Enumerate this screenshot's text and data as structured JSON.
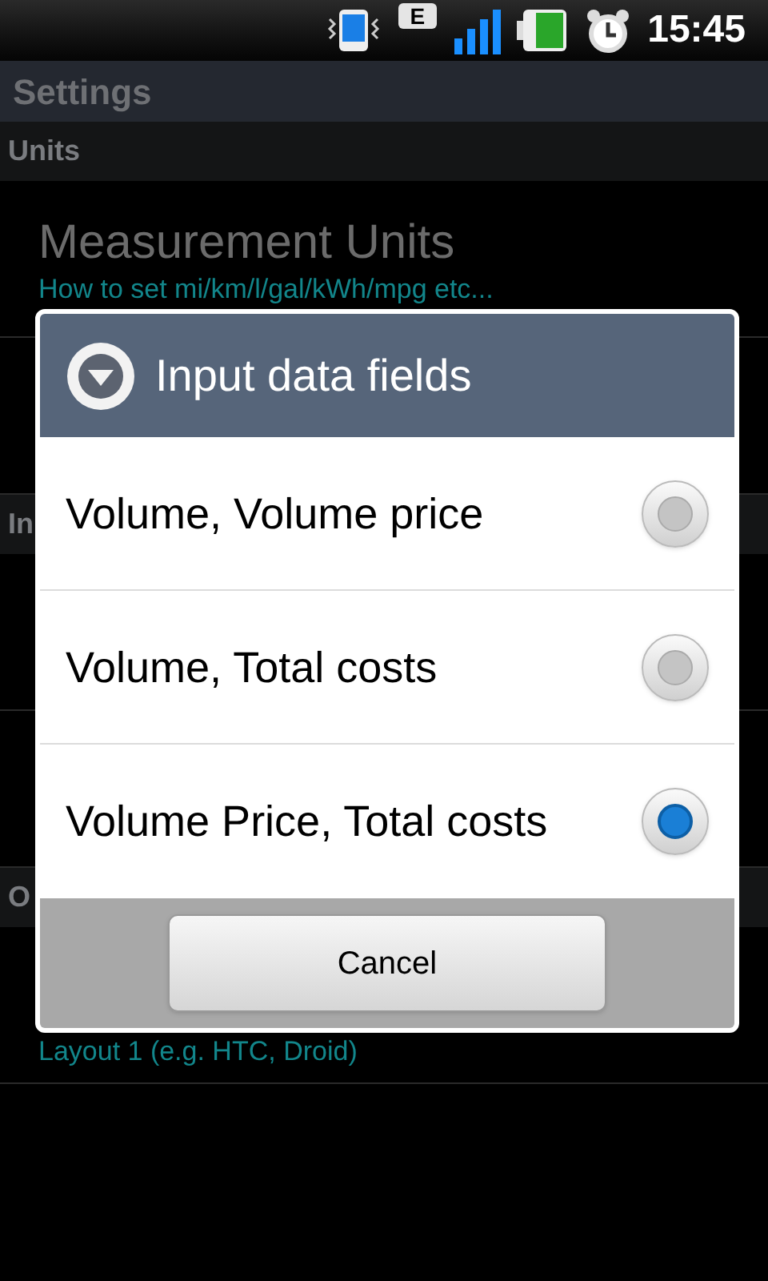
{
  "status_bar": {
    "network": "E",
    "time": "15:45"
  },
  "title": "Settings",
  "rows": [
    {
      "kind": "header",
      "text": "Units"
    },
    {
      "kind": "item",
      "title": "Measurement Units",
      "summary": "How to set mi/km/l/gal/kWh/mpg etc..."
    },
    {
      "kind": "hidden"
    },
    {
      "kind": "header",
      "text": "In"
    },
    {
      "kind": "hidden"
    },
    {
      "kind": "hidden"
    },
    {
      "kind": "header",
      "text": "O"
    },
    {
      "kind": "item",
      "summary": "Layout 1 (e.g. HTC, Droid)"
    }
  ],
  "dialog": {
    "title": "Input data fields",
    "options": [
      {
        "label": "Volume, Volume price",
        "selected": false
      },
      {
        "label": "Volume, Total costs",
        "selected": false
      },
      {
        "label": "Volume Price, Total costs",
        "selected": true
      }
    ],
    "cancel": "Cancel"
  }
}
